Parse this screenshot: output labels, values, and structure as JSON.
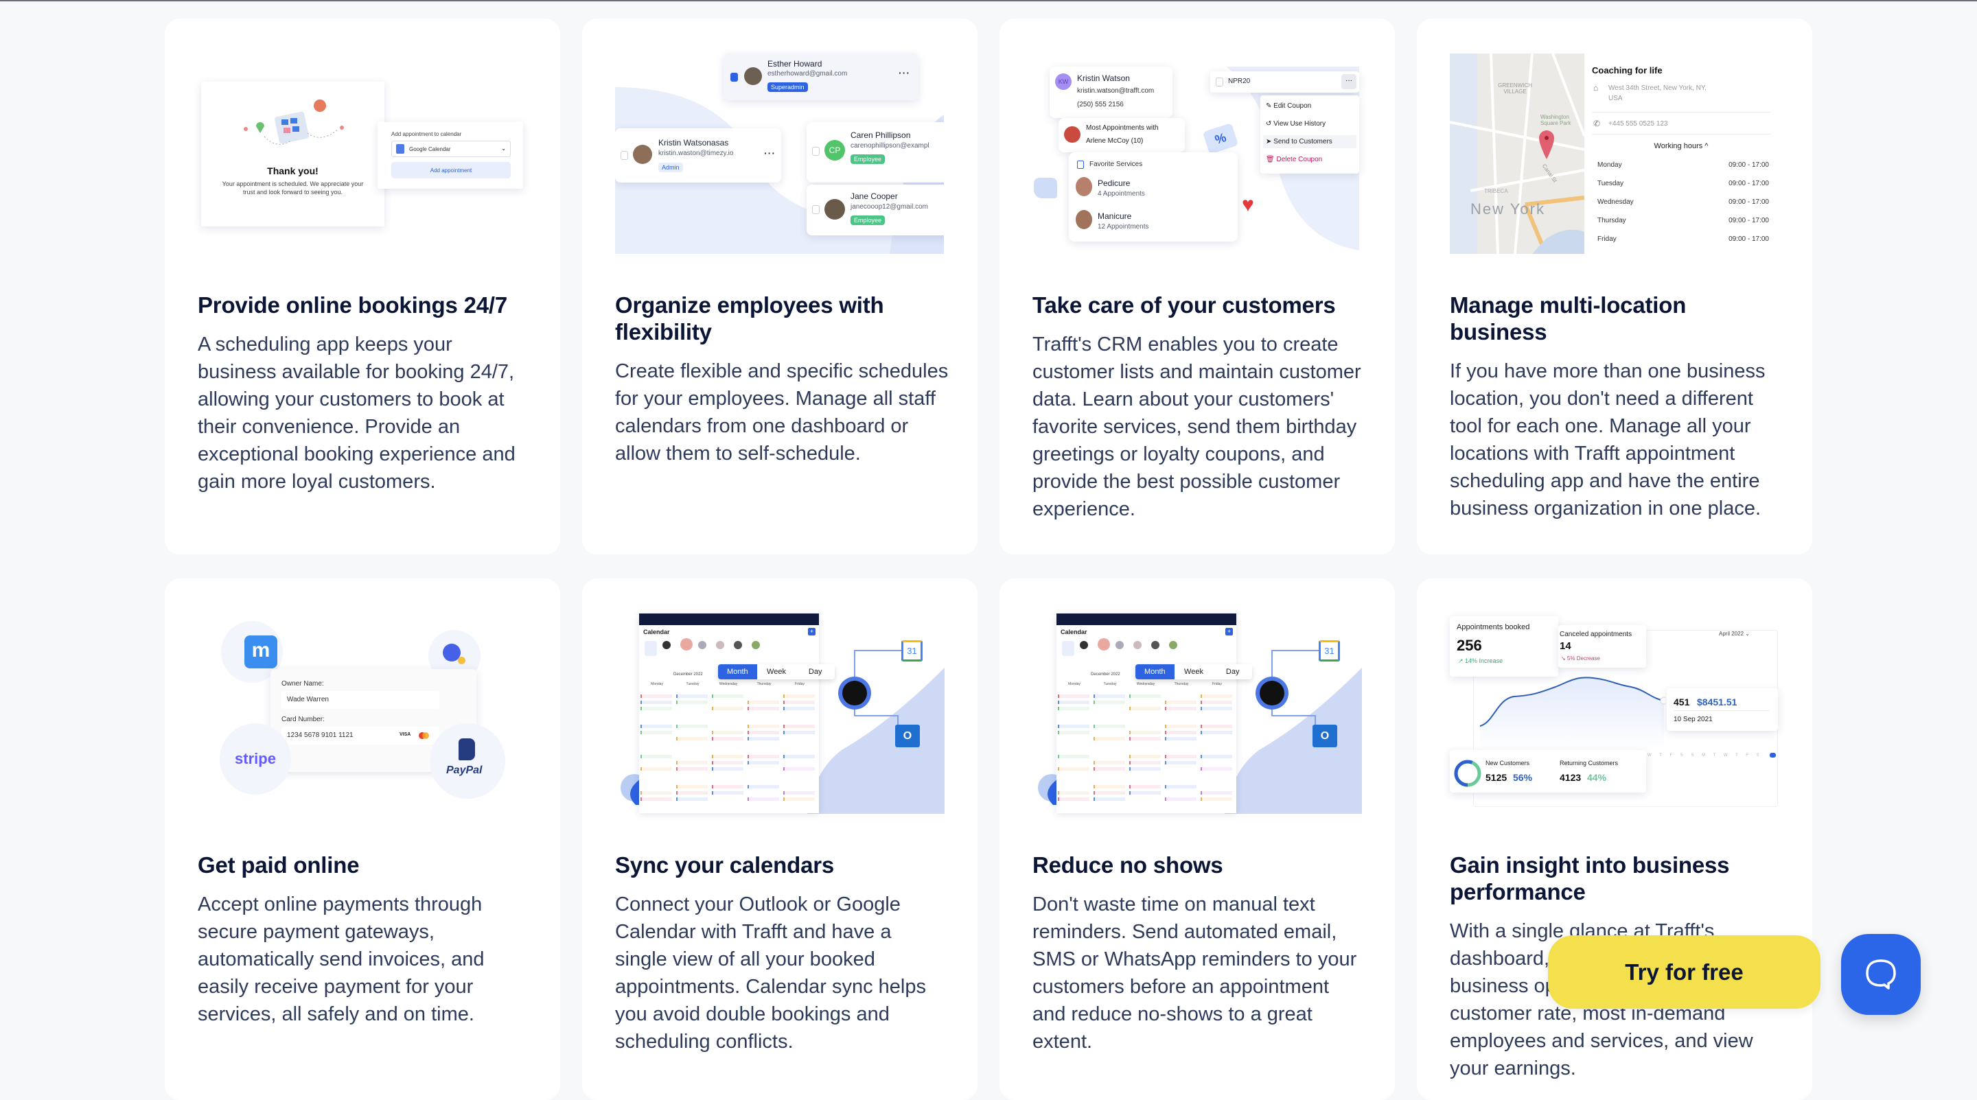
{
  "cards": [
    {
      "title": "Provide online bookings 24/7",
      "body": "A scheduling app keeps your business available for booking 24/7, allowing your customers to book at their convenience. Provide an exceptional booking experience and gain more loyal customers.",
      "illustration": {
        "thank_title": "Thank you!",
        "thank_text": "Your appointment is scheduled. We appreciate your trust and look forward to seeing you.",
        "add_label": "Add appointment to calendar",
        "select_value": "Google Calendar",
        "add_button": "Add appointment"
      }
    },
    {
      "title": "Organize employees with flexibility",
      "body": "Create flexible and specific schedules for your employees. Manage all staff calendars from one dashboard or allow them to self-schedule.",
      "illustration": {
        "employees": [
          {
            "name": "Esther Howard",
            "email": "estherhoward@gmail.com",
            "role": "Superadmin"
          },
          {
            "name": "Kristin Watsonasas",
            "email": "kristin.waston@timezy.io",
            "role": "Admin"
          },
          {
            "name": "Caren Phillipson",
            "email": "carenophillipson@exampl",
            "role": "Employee",
            "initials": "CP"
          },
          {
            "name": "Jane Cooper",
            "email": "janecooop12@gmail.com",
            "role": "Employee"
          }
        ]
      }
    },
    {
      "title": "Take care of your customers",
      "body": "Trafft's CRM enables you to create customer lists and maintain customer data. Learn about your customers' favorite services, send them birthday greetings or loyalty coupons, and provide the best possible customer experience.",
      "illustration": {
        "customer": {
          "initials": "KW",
          "name": "Kristin Watson",
          "email": "kristin.watson@trafft.com",
          "phone": "(250) 555 2156"
        },
        "most_line1": "Most Appointments with",
        "most_line2": "Arlene McCoy (10)",
        "fav_title": "Favorite Services",
        "services": [
          {
            "name": "Pedicure",
            "count": "4 Appointments"
          },
          {
            "name": "Manicure",
            "count": "12 Appointments"
          }
        ],
        "coupon": "NPR20",
        "percent": "%",
        "menu": [
          "Edit Coupon",
          "View Use History",
          "Send to Customers",
          "Delete Coupon"
        ]
      }
    },
    {
      "title": "Manage multi-location business",
      "body": "If you have more than one business location, you don't need a different tool for each one. Manage all your locations with Trafft appointment scheduling app and have the entire business organization in one place.",
      "illustration": {
        "map_labels": {
          "city": "New York",
          "village": "GREENWICH VILLAGE",
          "park": "Washington Square Park",
          "tribeca": "TRIBECA",
          "canal": "Canal St"
        },
        "location": "Coaching for life",
        "address": "West 34th Street, New York, NY, USA",
        "phone": "+445 555 0525 123",
        "hours_label": "Working hours",
        "hours": [
          {
            "day": "Monday",
            "time": "09:00 - 17:00"
          },
          {
            "day": "Tuesday",
            "time": "09:00 - 17:00"
          },
          {
            "day": "Wednesday",
            "time": "09:00 - 17:00"
          },
          {
            "day": "Thursday",
            "time": "09:00 - 17:00"
          },
          {
            "day": "Friday",
            "time": "09:00 - 17:00"
          }
        ]
      }
    },
    {
      "title": "Get paid online",
      "body": "Accept online payments through secure payment gateways, automatically send invoices, and easily receive payment for your services, all safely and on time.",
      "illustration": {
        "owner_label": "Owner Name:",
        "owner_value": "Wade Warren",
        "card_label": "Card Number:",
        "card_value": "1234 5678 9101 1121",
        "visa": "VISA",
        "mollie": "m",
        "stripe": "stripe",
        "paypal": "PayPal"
      }
    },
    {
      "title": "Sync your calendars",
      "body": "Connect your Outlook or Google Calendar with Trafft and have a single view of all your booked appointments. Calendar sync helps you avoid double bookings and scheduling conflicts.",
      "illustration": {
        "calendar_title": "Calendar",
        "month": "December 2022",
        "tabs": [
          "Month",
          "Week",
          "Day"
        ],
        "days": [
          "Monday",
          "Tuesday",
          "Wednesday",
          "Thursday",
          "Friday"
        ],
        "gcal": "31",
        "outlook": "O"
      }
    },
    {
      "title": "Reduce no shows",
      "body": "Don't waste time on manual text reminders. Send automated email, SMS or WhatsApp reminders to your customers before an appointment and reduce no-shows to a great extent.",
      "illustration": {
        "calendar_title": "Calendar",
        "month": "December 2022",
        "tabs": [
          "Month",
          "Week",
          "Day"
        ],
        "days": [
          "Monday",
          "Tuesday",
          "Wednesday",
          "Thursday",
          "Friday"
        ],
        "gcal": "31",
        "outlook": "O"
      }
    },
    {
      "title": "Gain insight into business performance",
      "body": "With a single glance at Trafft's dashboard, you can see how your business operates, your returning customer rate, most in-demand employees and services, and view your earnings.",
      "illustration": {
        "booked_label": "Appointments booked",
        "booked_value": "256",
        "booked_change": "↗ 14% Increase",
        "canceled_label": "Canceled appointments",
        "canceled_value": "14",
        "canceled_change": "↘ 5% Decrease",
        "period": "April 2022 ⌄",
        "tooltip_count": "451",
        "tooltip_amount": "$8451.51",
        "tooltip_date": "10 Sep 2021",
        "new_label": "New Customers",
        "new_value": "5125",
        "new_pct": "56%",
        "ret_label": "Returning Customers",
        "ret_value": "4123",
        "ret_pct": "44%",
        "weekdays": "W T F S S M T W T F S"
      }
    }
  ],
  "cta": {
    "label": "Try for free"
  },
  "chat": {
    "icon": "chat-bubble-icon"
  },
  "colors": {
    "cta": "#f4e04d",
    "chat": "#2c66e8",
    "heading": "#0b1535",
    "body": "#2e3a59",
    "background": "#f7f8fa"
  }
}
